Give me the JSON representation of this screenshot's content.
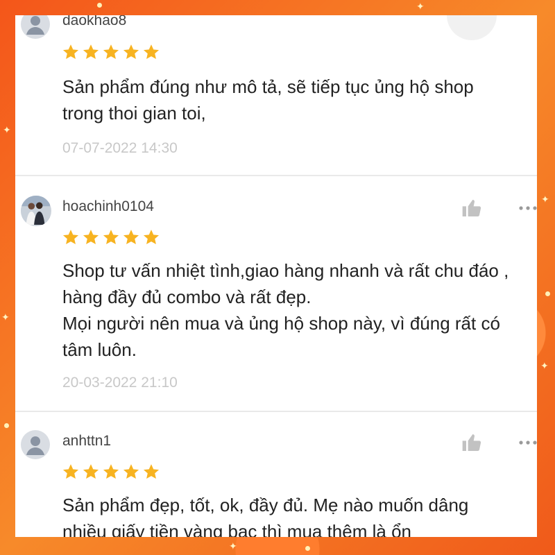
{
  "reviews": [
    {
      "username": "daokhao8",
      "stars": 5,
      "comment_lines": [
        "Sản phẩm đúng như mô tả, sẽ tiếp tục ủng hộ shop",
        "trong thoi gian toi,"
      ],
      "timestamp": "07-07-2022 14:30"
    },
    {
      "username": "hoachinh0104",
      "stars": 5,
      "comment_lines": [
        "Shop tư vấn nhiệt tình,giao hàng nhanh và rất chu đáo ,",
        "hàng đầy đủ combo và rất đẹp.",
        "Mọi người nên mua và ủng hộ shop này, vì đúng rất có",
        "tâm luôn."
      ],
      "timestamp": "20-03-2022 21:10"
    },
    {
      "username": "anhttn1",
      "stars": 5,
      "comment_lines": [
        "Sản phẩm đẹp, tốt, ok, đầy đủ. Mẹ nào muốn dâng",
        "nhiều giấy tiền vàng bạc thì mua thêm là ổn"
      ],
      "timestamp": ""
    }
  ],
  "colors": {
    "star": "#f7b321",
    "frame": "#f26a1b",
    "timestamp": "#c8c8c8"
  },
  "icons": [
    "user-avatar-icon",
    "thumbs-up-icon",
    "more-options-icon",
    "star-icon"
  ]
}
